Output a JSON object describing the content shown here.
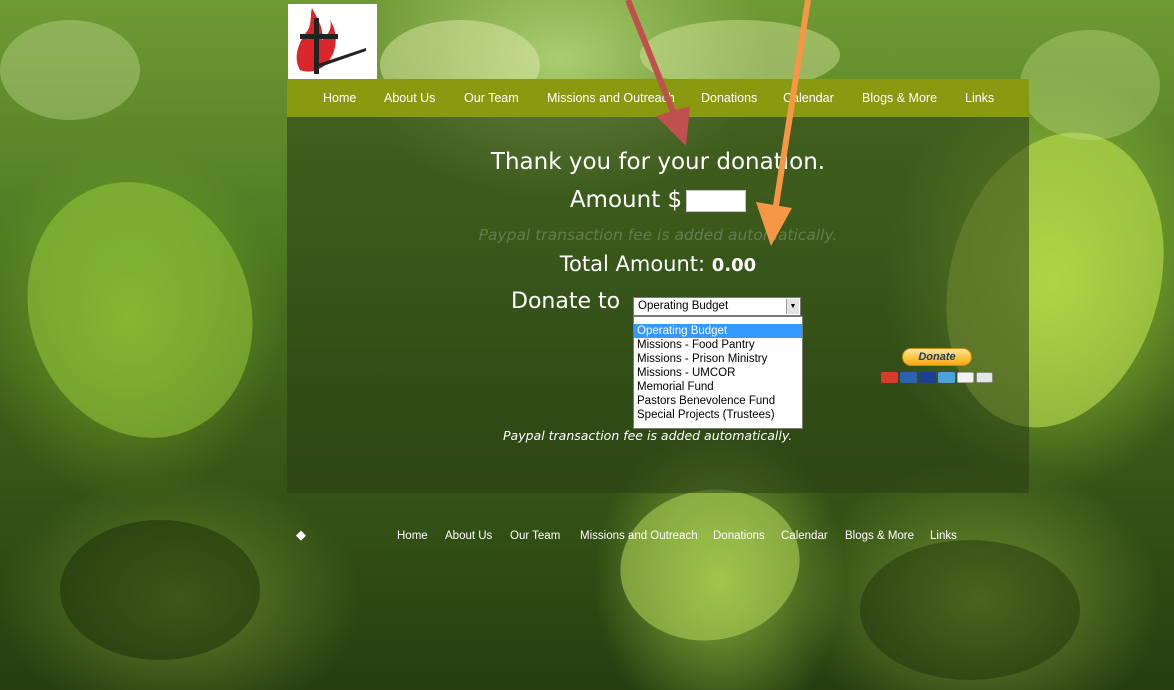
{
  "nav": {
    "items": [
      "Home",
      "About Us",
      "Our Team",
      "Missions and Outreach",
      "Donations",
      "Calendar",
      "Blogs & More",
      "Links"
    ]
  },
  "donation": {
    "thank_you": "Thank you for your donation.",
    "amount_label": "Amount $",
    "amount_value": "",
    "fee_faint": "Paypal transaction fee is added automatically.",
    "total_label": "Total Amount:",
    "total_value": "0.00",
    "donate_to_label": "Donate to",
    "selected_fund": "Operating Budget",
    "options": [
      "Operating Budget",
      "Missions - Food Pantry",
      "Missions - Prison Ministry",
      "Missions - UMCOR",
      "Memorial Fund",
      "Pastors Benevolence Fund",
      "Special Projects (Trustees)"
    ],
    "fee_note": "Paypal transaction fee is added automatically."
  },
  "paypal": {
    "button_label": "Donate",
    "card_icons": [
      "mastercard-icon",
      "maestro-icon",
      "visa-icon",
      "amex-icon",
      "discover-icon",
      "bank-icon"
    ]
  },
  "footer": {
    "items": [
      "Home",
      "About Us",
      "Our Team",
      "Missions and Outreach",
      "Donations",
      "Calendar",
      "Blogs & More",
      "Links"
    ]
  },
  "colors": {
    "nav_bar": "#8a9a10",
    "panel": "rgba(40,60,20,0.55)",
    "selected_option": "#3399ff",
    "annotation_red": "#c0504d",
    "annotation_orange": "#f79646",
    "logo_flame": "#d8262b"
  }
}
